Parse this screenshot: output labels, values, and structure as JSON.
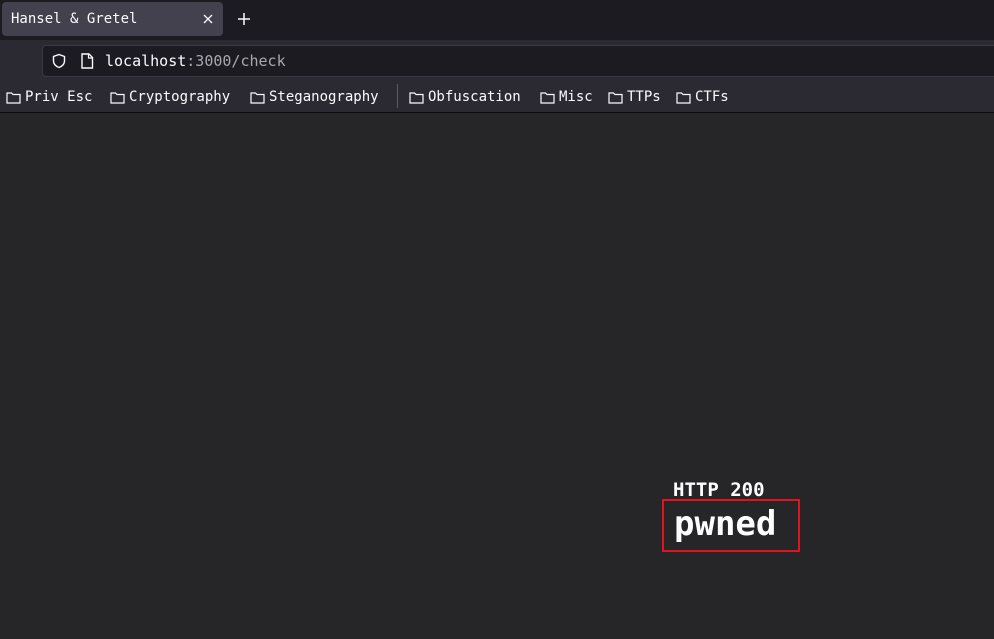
{
  "tabbar": {
    "tab_title": "Hansel & Gretel",
    "close_icon": "close-icon",
    "new_tab_icon": "plus-icon"
  },
  "navbar": {
    "url_host": "localhost",
    "url_path": ":3000/check",
    "shield_icon": "shield-icon",
    "page_icon": "page-icon"
  },
  "bookmarks": {
    "items": [
      {
        "label": "Priv Esc",
        "icon": "folder-icon"
      },
      {
        "label": "Cryptography",
        "icon": "folder-icon"
      },
      {
        "label": "Steganography",
        "icon": "folder-icon"
      },
      {
        "label": "Obfuscation",
        "icon": "folder-icon"
      },
      {
        "label": "Misc",
        "icon": "folder-icon"
      },
      {
        "label": "TTPs",
        "icon": "folder-icon"
      },
      {
        "label": "CTFs",
        "icon": "folder-icon"
      }
    ]
  },
  "content": {
    "status": "HTTP 200",
    "message": "pwned",
    "highlight_color": "#e0141e"
  }
}
